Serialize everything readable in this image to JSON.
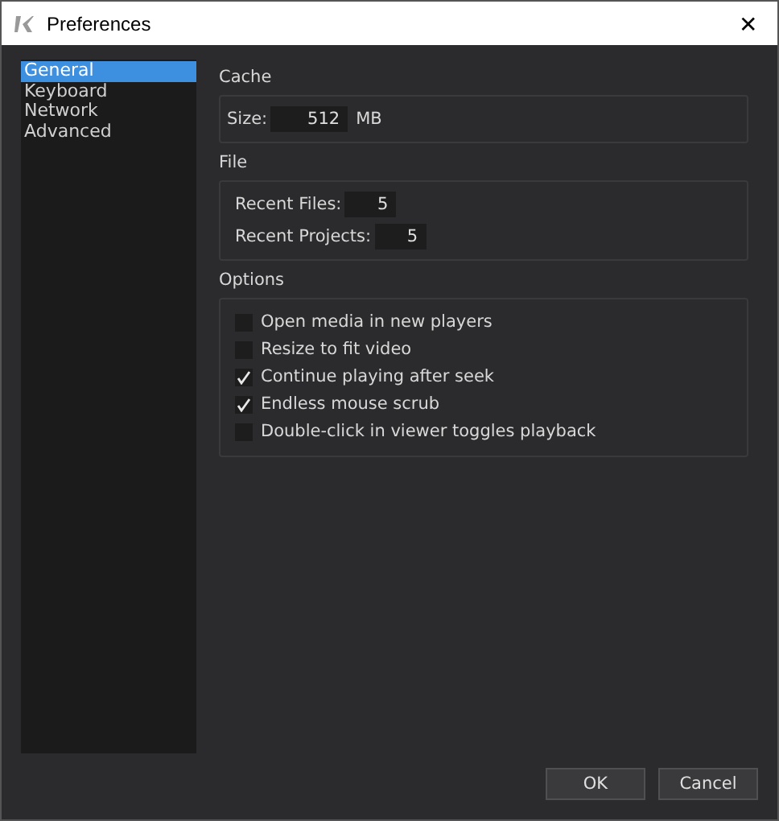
{
  "window": {
    "title": "Preferences",
    "close": "✕"
  },
  "sidebar": {
    "items": [
      {
        "label": "General",
        "selected": true
      },
      {
        "label": "Keyboard",
        "selected": false
      },
      {
        "label": "Network",
        "selected": false
      },
      {
        "label": "Advanced",
        "selected": false
      }
    ]
  },
  "cache": {
    "title": "Cache",
    "size_label": "Size:",
    "size_value": "512",
    "unit": "MB"
  },
  "file": {
    "title": "File",
    "fields": [
      {
        "label": "Recent Files:",
        "value": "5"
      },
      {
        "label": "Recent Projects:",
        "value": "5"
      }
    ]
  },
  "options": {
    "title": "Options",
    "items": [
      {
        "label": "Open media in new players",
        "checked": false
      },
      {
        "label": "Resize to fit video",
        "checked": false
      },
      {
        "label": "Continue playing after seek",
        "checked": true
      },
      {
        "label": "Endless mouse scrub",
        "checked": true
      },
      {
        "label": "Double-click in viewer toggles playback",
        "checked": false
      }
    ]
  },
  "buttons": [
    "OK",
    "Cancel"
  ]
}
